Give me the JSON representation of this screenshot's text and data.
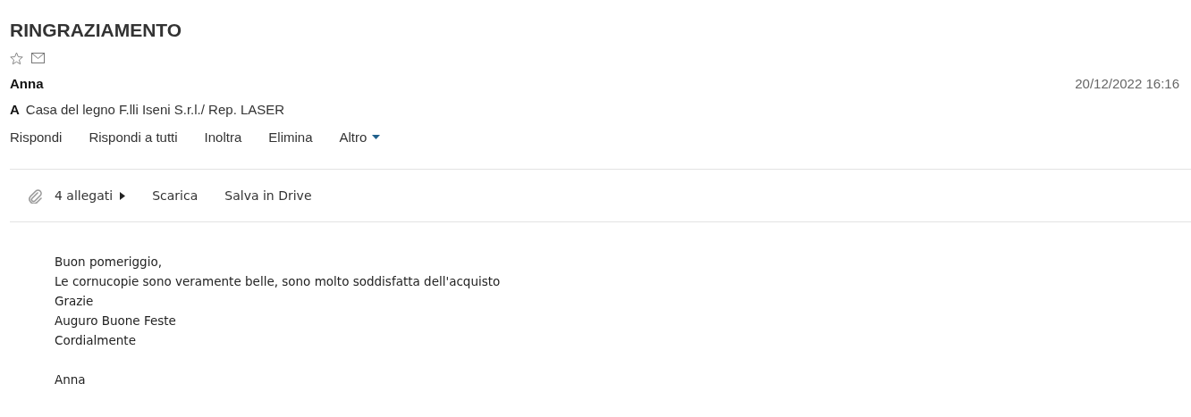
{
  "subject": "RINGRAZIAMENTO",
  "flags": {
    "starred": false
  },
  "sender": "Anna",
  "date": "20/12/2022 16:16",
  "recipient": {
    "label": "A",
    "name": "Casa del legno F.lli Iseni S.r.l./ Rep. LASER"
  },
  "actions": [
    {
      "label": "Rispondi",
      "kind": "plain"
    },
    {
      "label": "Rispondi a tutti",
      "kind": "plain"
    },
    {
      "label": "Inoltra",
      "kind": "plain"
    },
    {
      "label": "Elimina",
      "kind": "plain"
    },
    {
      "label": "Altro",
      "kind": "menu"
    }
  ],
  "attachments": {
    "count": "4 allegati",
    "expanded": false,
    "actions": [
      "Scarica",
      "Salva in Drive"
    ]
  },
  "body": [
    [
      "Buon pomeriggio,",
      "Le cornucopie sono veramente belle, sono molto soddisfatta dell'acquisto",
      "Grazie",
      "Auguro Buone Feste",
      "Cordialmente"
    ],
    [
      "Anna"
    ]
  ]
}
